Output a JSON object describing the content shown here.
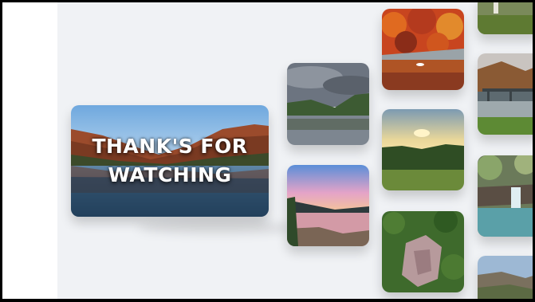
{
  "hero": {
    "line1": "THANK'S FOR",
    "line2": "WATCHING"
  },
  "colors": {
    "background": "#f0f2f5",
    "frame_border": "#000000",
    "hero_text": "#ffffff"
  }
}
